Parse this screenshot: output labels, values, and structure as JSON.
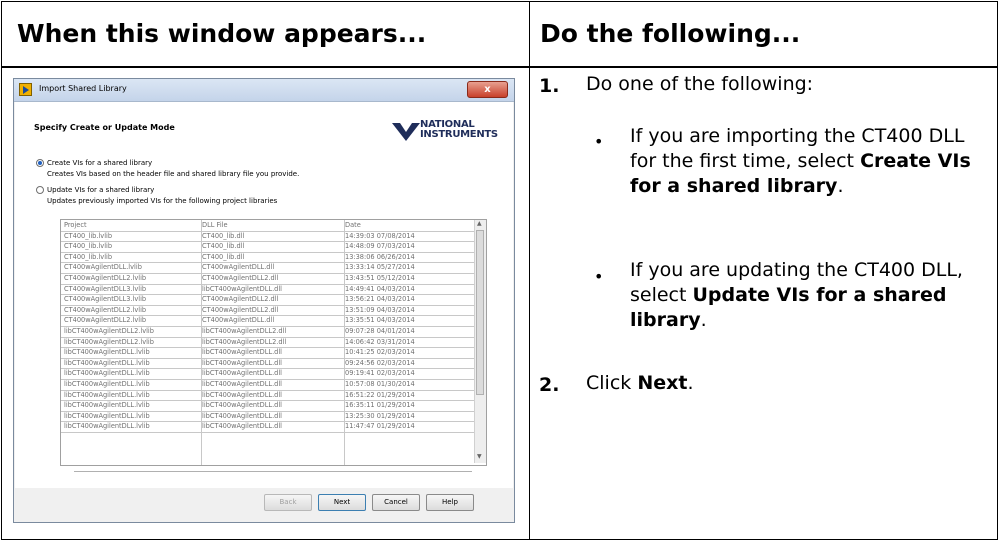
{
  "table": {
    "left_header": "When this window appears...",
    "right_header": "Do the following..."
  },
  "dialog": {
    "title": "Import Shared Library",
    "close_label": "x",
    "heading": "Specify Create or Update Mode",
    "logo_line1": "NATIONAL",
    "logo_line2": "INSTRUMENTS",
    "option_create_label": "Create VIs for a shared library",
    "option_create_desc": "Creates VIs based on the header file and shared library file you provide.",
    "option_update_label": "Update VIs for a shared library",
    "option_update_desc": "Updates previously imported VIs for the following project libraries",
    "selected_option": "create",
    "columns": [
      "Project",
      "DLL File",
      "Date"
    ],
    "rows": [
      [
        "CT400_lib.lvlib",
        "CT400_lib.dll",
        "14:39:03 07/08/2014"
      ],
      [
        "CT400_lib.lvlib",
        "CT400_lib.dll",
        "14:48:09 07/03/2014"
      ],
      [
        "CT400_lib.lvlib",
        "CT400_lib.dll",
        "13:38:06 06/26/2014"
      ],
      [
        "CT400wAgilentDLL.lvlib",
        "CT400wAgilentDLL.dll",
        "13:33:14 05/27/2014"
      ],
      [
        "CT400wAgilentDLL2.lvlib",
        "CT400wAgilentDLL2.dll",
        "13:43:51 05/12/2014"
      ],
      [
        "CT400wAgilentDLL3.lvlib",
        "libCT400wAgilentDLL.dll",
        "14:49:41 04/03/2014"
      ],
      [
        "CT400wAgilentDLL3.lvlib",
        "CT400wAgilentDLL2.dll",
        "13:56:21 04/03/2014"
      ],
      [
        "CT400wAgilentDLL2.lvlib",
        "CT400wAgilentDLL2.dll",
        "13:51:09 04/03/2014"
      ],
      [
        "CT400wAgilentDLL2.lvlib",
        "CT400wAgilentDLL.dll",
        "13:35:51 04/03/2014"
      ],
      [
        "libCT400wAgilentDLL2.lvlib",
        "libCT400wAgilentDLL2.dll",
        "09:07:28 04/01/2014"
      ],
      [
        "libCT400wAgilentDLL2.lvlib",
        "libCT400wAgilentDLL2.dll",
        "14:06:42 03/31/2014"
      ],
      [
        "libCT400wAgilentDLL.lvlib",
        "libCT400wAgilentDLL.dll",
        "10:41:25 02/03/2014"
      ],
      [
        "libCT400wAgilentDLL.lvlib",
        "libCT400wAgilentDLL.dll",
        "09:24:56 02/03/2014"
      ],
      [
        "libCT400wAgilentDLL.lvlib",
        "libCT400wAgilentDLL.dll",
        "09:19:41 02/03/2014"
      ],
      [
        "libCT400wAgilentDLL.lvlib",
        "libCT400wAgilentDLL.dll",
        "10:57:08 01/30/2014"
      ],
      [
        "libCT400wAgilentDLL.lvlib",
        "libCT400wAgilentDLL.dll",
        "16:51:22 01/29/2014"
      ],
      [
        "libCT400wAgilentDLL.lvlib",
        "libCT400wAgilentDLL.dll",
        "16:35:11 01/29/2014"
      ],
      [
        "libCT400wAgilentDLL.lvlib",
        "libCT400wAgilentDLL.dll",
        "13:25:30 01/29/2014"
      ],
      [
        "libCT400wAgilentDLL.lvlib",
        "libCT400wAgilentDLL.dll",
        "11:47:47 01/29/2014"
      ]
    ],
    "buttons": {
      "back": "Back",
      "next": "Next",
      "cancel": "Cancel",
      "help": "Help"
    }
  },
  "steps": {
    "step1_num": "1.",
    "step1_text": "Do one of the following:",
    "bullet1_pre": "If you are importing the CT400 DLL for the first time, select ",
    "bullet1_bold": "Create VIs for a shared library",
    "bullet1_post": ".",
    "bullet2_pre": "If you are updating the CT400 DLL, select ",
    "bullet2_bold": "Update VIs for a shared library",
    "bullet2_post": ".",
    "step2_num": "2.",
    "step2_pre": "Click ",
    "step2_bold": "Next",
    "step2_post": "."
  }
}
